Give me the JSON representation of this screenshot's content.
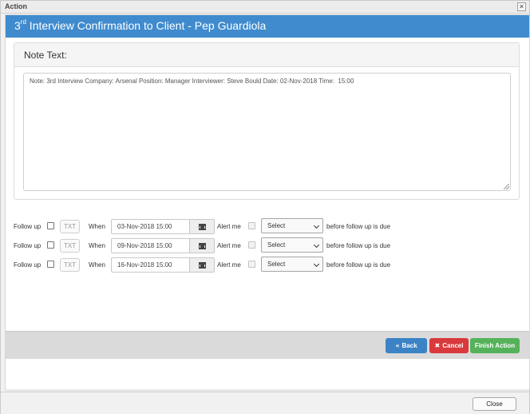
{
  "window": {
    "title": "Action",
    "close_glyph": "✕"
  },
  "header": {
    "title_prefix": "3",
    "title_sup": "rd",
    "title_rest": " Interview Confirmation to Client - Pep Guardiola",
    "color": "#3f8bce"
  },
  "note_panel": {
    "title": "Note Text:",
    "text": "Note: 3rd Interview Company: Arsenal Position: Manager Interviewer: Steve Bould Date: 02-Nov-2018 Time:  15:00"
  },
  "follow_ups": [
    {
      "label": "Follow up",
      "txt": "TXT",
      "when_label": "When",
      "date": "03-Nov-2018 15:00",
      "alert_label": "Alert me",
      "select": "Select",
      "suffix": "before follow up is due"
    },
    {
      "label": "Follow up",
      "txt": "TXT",
      "when_label": "When",
      "date": "09-Nov-2018 15:00",
      "alert_label": "Alert me",
      "select": "Select",
      "suffix": "before follow up is due"
    },
    {
      "label": "Follow up",
      "txt": "TXT",
      "when_label": "When",
      "date": "16-Nov-2018 15:00",
      "alert_label": "Alert me",
      "select": "Select",
      "suffix": "before follow up is due"
    }
  ],
  "actions": {
    "back": {
      "label": "Back",
      "icon": "«",
      "color": "#3b83c5"
    },
    "cancel": {
      "label": "Cancel",
      "icon": "✖",
      "color": "#d9393c"
    },
    "finish": {
      "label": "Finish Action",
      "color": "#55b25a"
    }
  },
  "footer": {
    "close_label": "Close"
  },
  "icons": {
    "calendar": "calendar-icon",
    "chevron": "chevron-down-icon",
    "resize": "resize-grip-icon"
  }
}
